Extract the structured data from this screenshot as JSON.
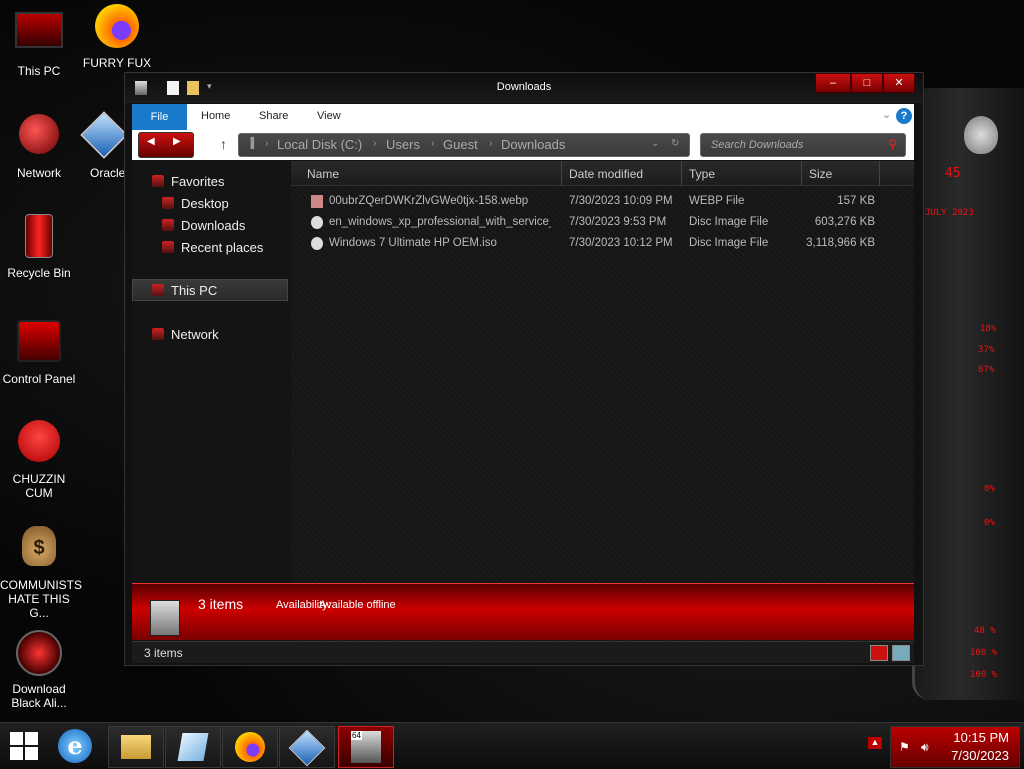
{
  "desktop": {
    "icons": [
      {
        "label": "This PC"
      },
      {
        "label": "FURRY FUX"
      },
      {
        "label": "Network"
      },
      {
        "label": "Oracle VM VirtualBox"
      },
      {
        "label": "Recycle Bin"
      },
      {
        "label": "Control Panel"
      },
      {
        "label": "CHUZZIN CUM"
      },
      {
        "label": "COMMUNISTS HATE THIS G..."
      },
      {
        "label": "Download Black Ali..."
      }
    ]
  },
  "gadget": {
    "values": [
      "45",
      "JULY 2023",
      "18%",
      "37%",
      "87%",
      "0%",
      "0%",
      "48 %",
      "100 %",
      "100 %"
    ]
  },
  "window": {
    "title": "Downloads",
    "buttons": {
      "minimize": "‒",
      "maximize": "□",
      "close": "✕"
    },
    "ribbon": {
      "file": "File",
      "tabs": [
        "Home",
        "Share",
        "View"
      ],
      "help": "?"
    },
    "address": {
      "crumbs": [
        "Local Disk (C:)",
        "Users",
        "Guest",
        "Downloads"
      ]
    },
    "search": {
      "placeholder": "Search Downloads"
    },
    "nav": {
      "favorites": "Favorites",
      "favorite_items": [
        "Desktop",
        "Downloads",
        "Recent places"
      ],
      "this_pc": "This PC",
      "network": "Network"
    },
    "columns": [
      "Name",
      "Date modified",
      "Type",
      "Size"
    ],
    "files": [
      {
        "name": "00ubrZQerDWKrZlvGWe0tjx-158.webp",
        "date": "7/30/2023 10:09 PM",
        "type": "WEBP File",
        "size": "157 KB"
      },
      {
        "name": "en_windows_xp_professional_with_service_...",
        "date": "7/30/2023 9:53 PM",
        "type": "Disc Image File",
        "size": "603,276 KB"
      },
      {
        "name": "Windows 7 Ultimate HP OEM.iso",
        "date": "7/30/2023 10:12 PM",
        "type": "Disc Image File",
        "size": "3,118,966 KB"
      }
    ],
    "details": {
      "count": "3 items",
      "availability_label": "Availability:",
      "availability_value": "Available offline"
    },
    "status": "3 items"
  },
  "taskbar": {
    "clock_time": "10:15 PM",
    "clock_date": "7/30/2023",
    "badge": "64"
  },
  "colors": {
    "accent_red": "#cc0000",
    "ribbon_blue": "#1979ca"
  }
}
